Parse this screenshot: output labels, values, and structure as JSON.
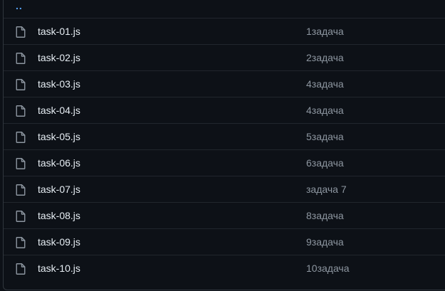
{
  "parent_dir": {
    "label": ".."
  },
  "files": [
    {
      "name": "task-01.js",
      "commit": "1задача"
    },
    {
      "name": "task-02.js",
      "commit": "2задача"
    },
    {
      "name": "task-03.js",
      "commit": "4задача"
    },
    {
      "name": "task-04.js",
      "commit": "4задача"
    },
    {
      "name": "task-05.js",
      "commit": "5задача"
    },
    {
      "name": "task-06.js",
      "commit": "6задача"
    },
    {
      "name": "task-07.js",
      "commit": "задача 7"
    },
    {
      "name": "task-08.js",
      "commit": "8задача"
    },
    {
      "name": "task-09.js",
      "commit": "9задача"
    },
    {
      "name": "task-10.js",
      "commit": "10задача"
    }
  ],
  "icons": {
    "file": "file-icon"
  },
  "colors": {
    "background": "#0d1117",
    "border": "#30363d",
    "link": "#58a6ff",
    "text": "#e6edf3",
    "muted": "#8d96a0"
  }
}
